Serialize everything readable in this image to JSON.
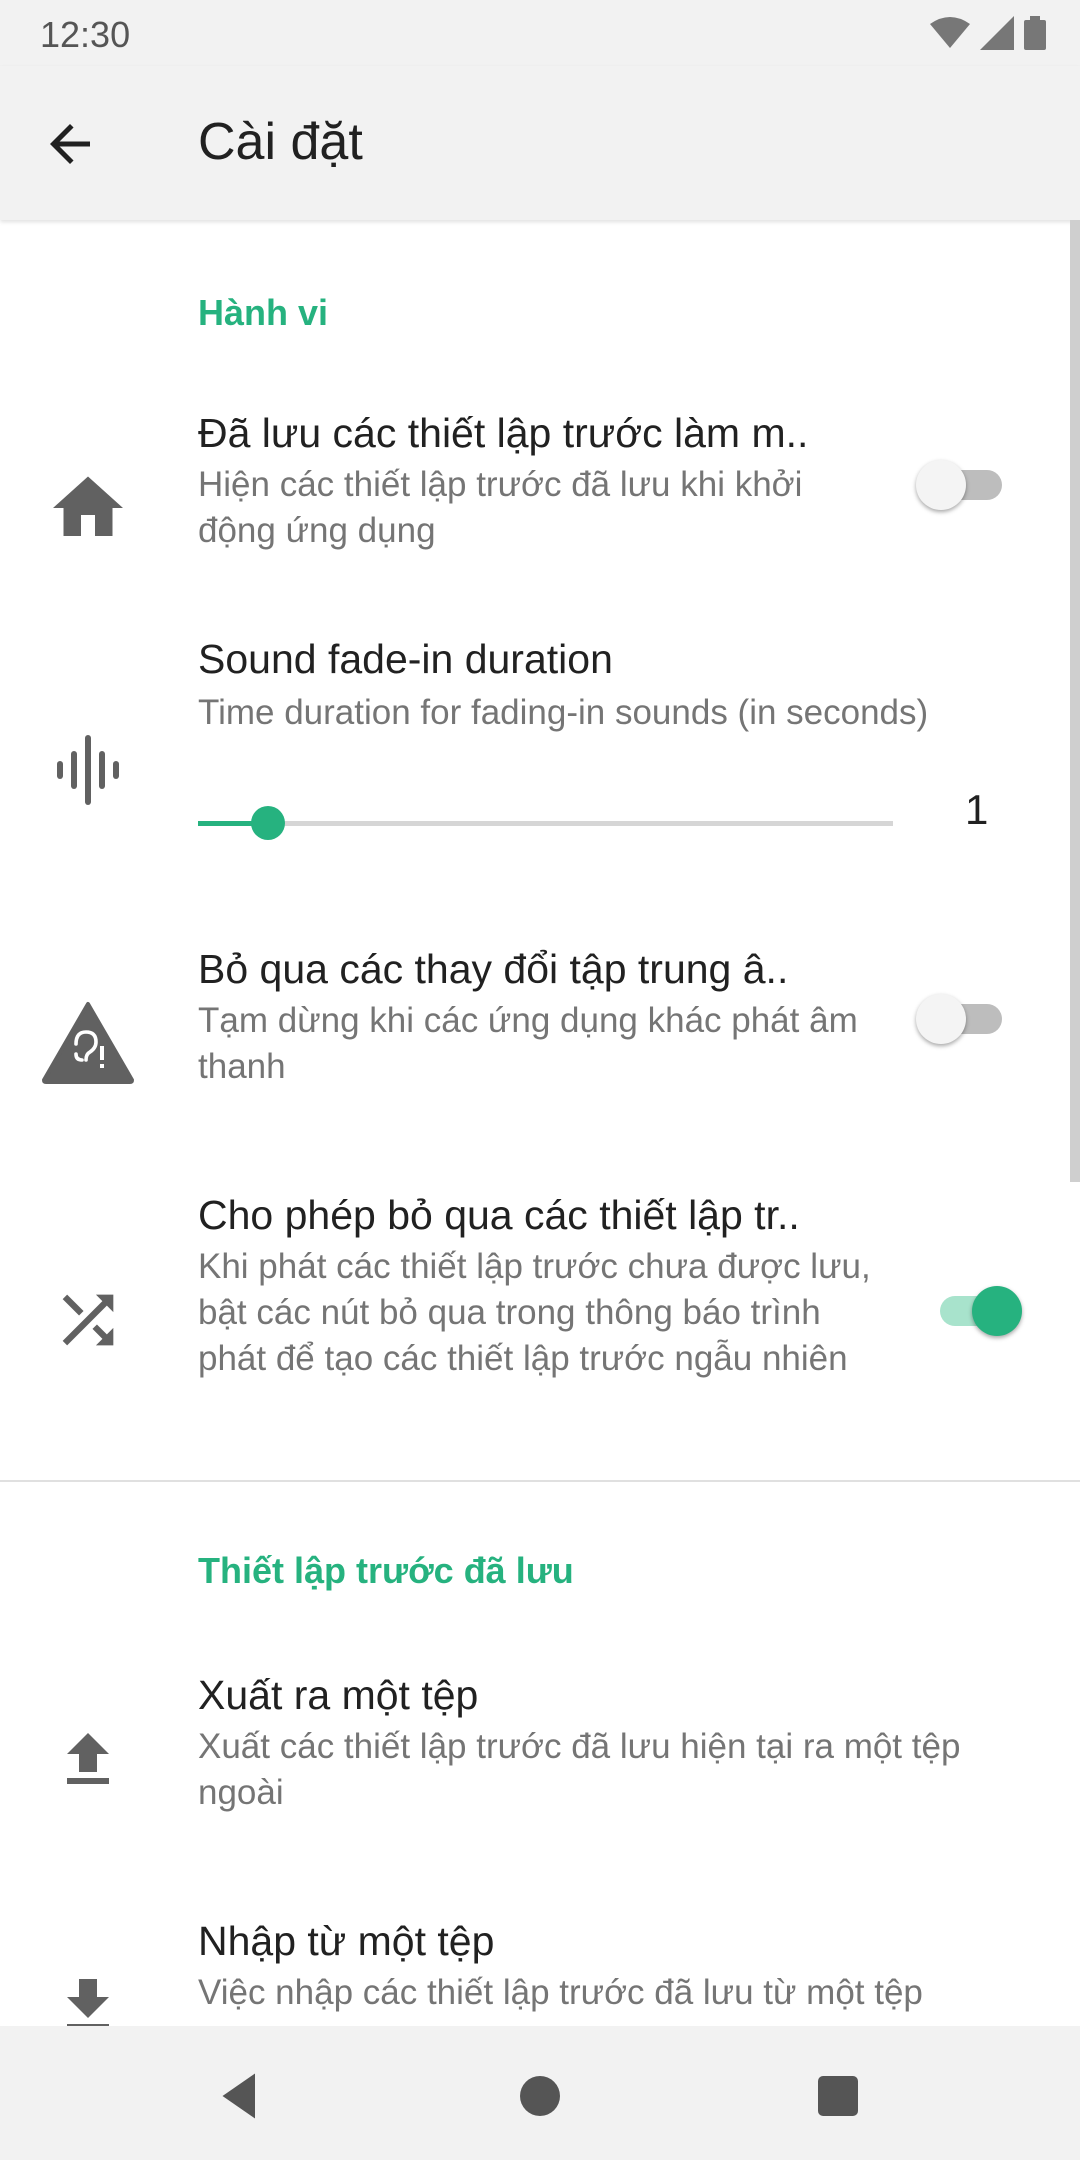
{
  "status": {
    "time": "12:30"
  },
  "appbar": {
    "title": "Cài đặt"
  },
  "sections": {
    "behavior": {
      "title": "Hành vi"
    },
    "saved": {
      "title": "Thiết lập trước đã lưu"
    }
  },
  "rows": {
    "saved_presets_home": {
      "title": "Đã lưu các thiết lập trước làm m..",
      "summary": "Hiện các thiết lập trước đã lưu khi khởi động ứng dụng",
      "enabled": false
    },
    "fade_in": {
      "title": "Sound fade-in duration",
      "summary": "Time duration for fading-in sounds (in seconds)",
      "value": "1",
      "level": 0.1
    },
    "audio_focus": {
      "title": "Bỏ qua các thay đổi tập trung â..",
      "summary": "Tạm dừng khi các ứng dụng khác phát âm thanh",
      "enabled": false
    },
    "skip_presets": {
      "title": "Cho phép bỏ qua các thiết lập tr..",
      "summary": "Khi phát các thiết lập trước chưa được lưu, bật các nút bỏ qua trong thông báo trình phát để tạo các thiết lập trước ngẫu nhiên",
      "enabled": true
    },
    "export": {
      "title": "Xuất ra một tệp",
      "summary": "Xuất các thiết lập trước đã lưu hiện tại ra một tệp ngoài"
    },
    "import": {
      "title": "Nhập từ một tệp",
      "summary": "Việc nhập các thiết lập trước đã lưu từ một tệp"
    }
  },
  "icons": {
    "back": "arrow-left-icon",
    "home": "home-icon",
    "waveform": "waveform-icon",
    "ear_warning": "ear-warning-icon",
    "shuffle": "shuffle-icon",
    "upload": "upload-icon",
    "download": "download-icon"
  },
  "colors": {
    "accent": "#26b27f",
    "text": "#212121",
    "secondary": "#757575"
  }
}
